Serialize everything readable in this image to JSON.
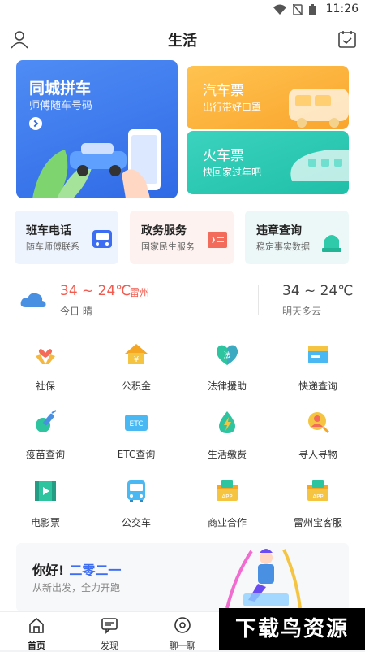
{
  "status": {
    "time": "11:26"
  },
  "header": {
    "title": "生活"
  },
  "cards": {
    "carpool": {
      "title": "同城拼车",
      "subtitle": "师傅随车号码"
    },
    "bus_ticket": {
      "title": "汽车票",
      "subtitle": "出行带好口罩"
    },
    "train_ticket": {
      "title": "火车票",
      "subtitle": "快回家过年吧"
    }
  },
  "services": [
    {
      "title": "班车电话",
      "subtitle": "随车师傅联系"
    },
    {
      "title": "政务服务",
      "subtitle": "国家民生服务"
    },
    {
      "title": "违章查询",
      "subtitle": "稳定事实数据"
    }
  ],
  "weather": {
    "today_temp": "34 ~ 24℃",
    "city": "雷州",
    "today_desc": "今日 晴",
    "tomorrow_temp": "34 ~ 24℃",
    "tomorrow_desc": "明天多云"
  },
  "grid": [
    {
      "label": "社保",
      "icon": "heart-hands-icon"
    },
    {
      "label": "公积金",
      "icon": "house-yuan-icon"
    },
    {
      "label": "法律援助",
      "icon": "law-heart-icon"
    },
    {
      "label": "快递查询",
      "icon": "package-icon"
    },
    {
      "label": "疫苗查询",
      "icon": "syringe-icon"
    },
    {
      "label": "ETC查询",
      "icon": "etc-card-icon"
    },
    {
      "label": "生活缴费",
      "icon": "lightning-drop-icon"
    },
    {
      "label": "寻人寻物",
      "icon": "search-person-icon"
    },
    {
      "label": "电影票",
      "icon": "film-icon"
    },
    {
      "label": "公交车",
      "icon": "bus-icon"
    },
    {
      "label": "商业合作",
      "icon": "app-box-icon"
    },
    {
      "label": "雷州宝客服",
      "icon": "app-box-icon"
    }
  ],
  "banner": {
    "greeting": "你好!",
    "year": "二零二一",
    "slogan": "从新出发，全力开跑"
  },
  "tabs": [
    {
      "label": "首页",
      "icon": "home-icon"
    },
    {
      "label": "发现",
      "icon": "chat-icon"
    },
    {
      "label": "聊一聊",
      "icon": "circle-dot-icon"
    }
  ],
  "watermark": "下载鸟资源",
  "colors": {
    "accent": "#3d6df3",
    "warm": "#f25b4f"
  }
}
